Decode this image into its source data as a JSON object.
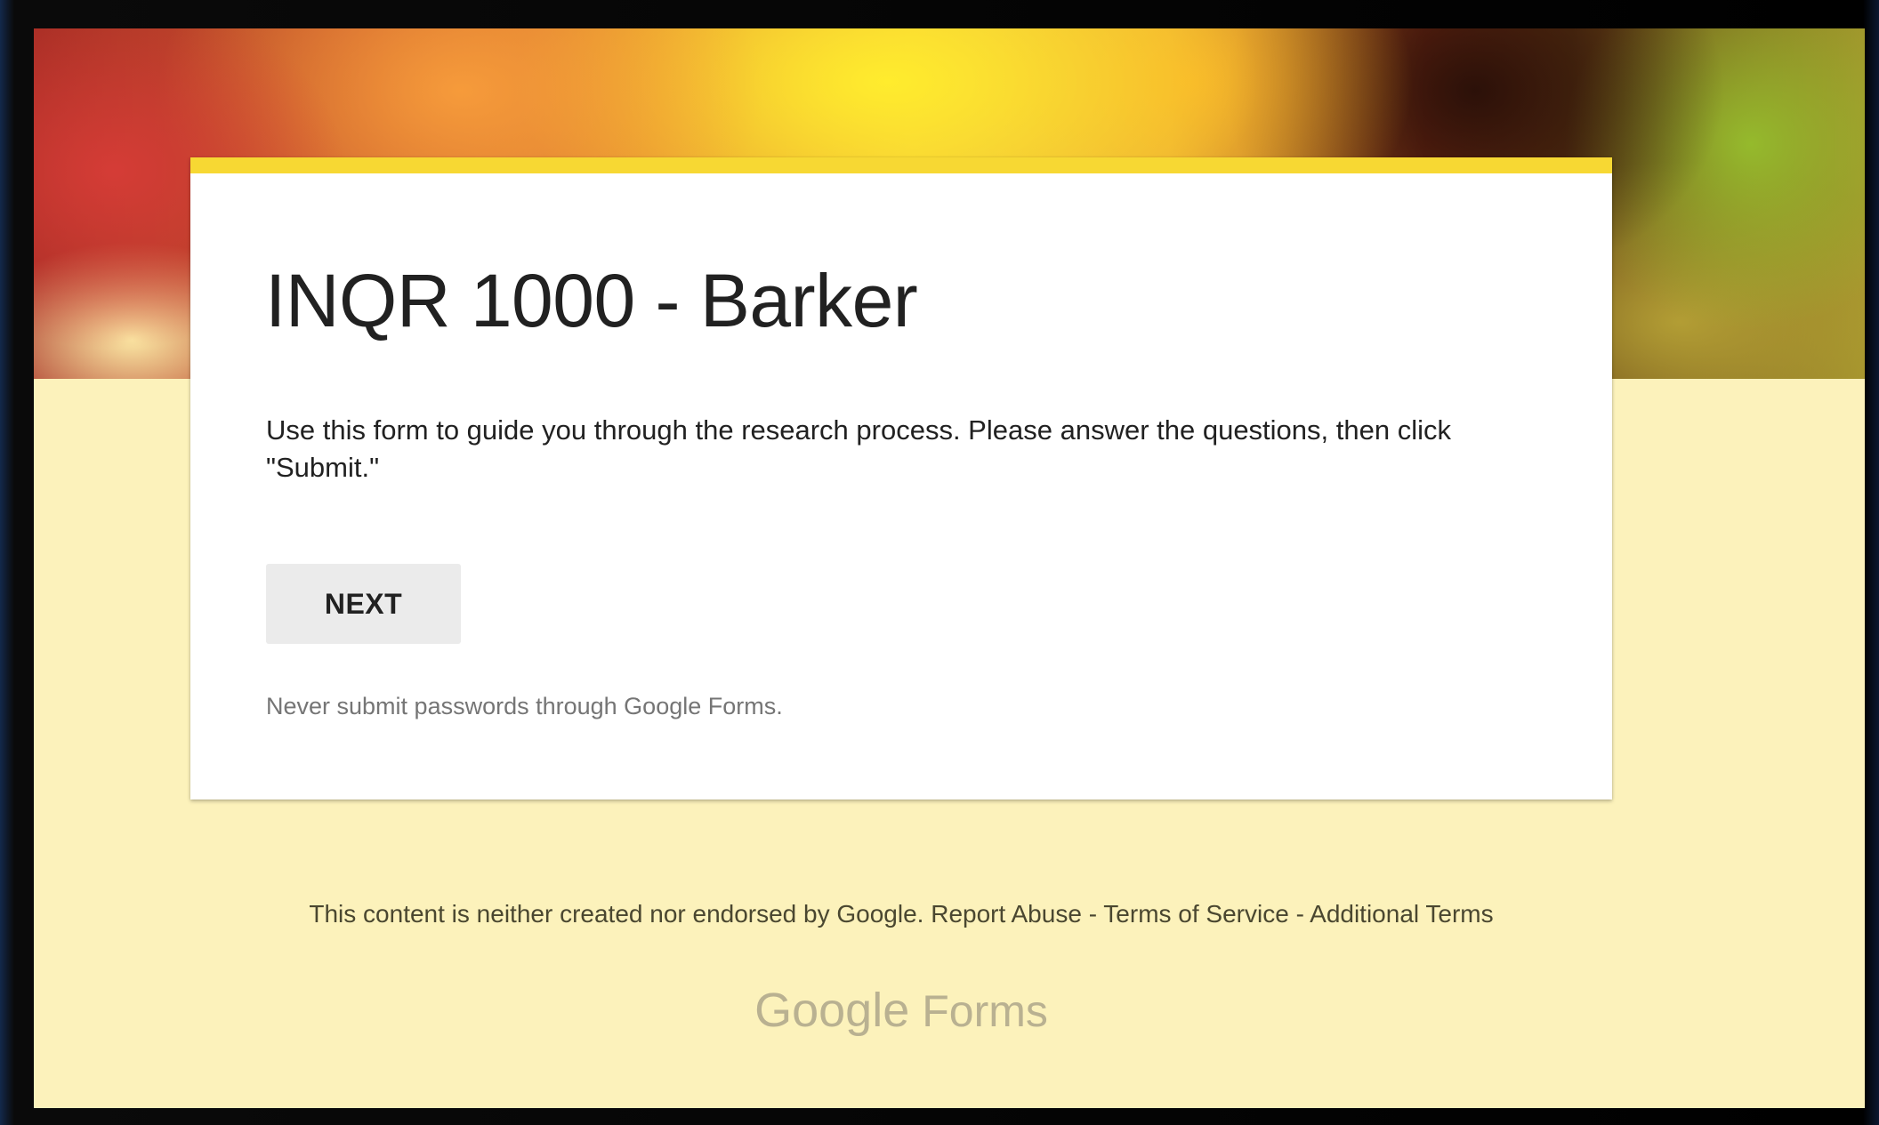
{
  "form": {
    "title": "INQR 1000 - Barker",
    "description": "Use this form to guide you through the research process. Please answer the questions, then click \"Submit.\"",
    "next_label": "NEXT",
    "password_warning": "Never submit passwords through Google Forms."
  },
  "footer": {
    "disclaimer": "This content is neither created nor endorsed by Google.",
    "report_abuse": "Report Abuse",
    "separator": "-",
    "terms_of_service": "Terms of Service",
    "additional_terms": "Additional Terms"
  },
  "branding": {
    "google": "Google",
    "forms": "Forms"
  },
  "colors": {
    "accent": "#f7d833",
    "page_background": "#fcf2bb",
    "card": "#ffffff",
    "button": "#ebebeb"
  }
}
